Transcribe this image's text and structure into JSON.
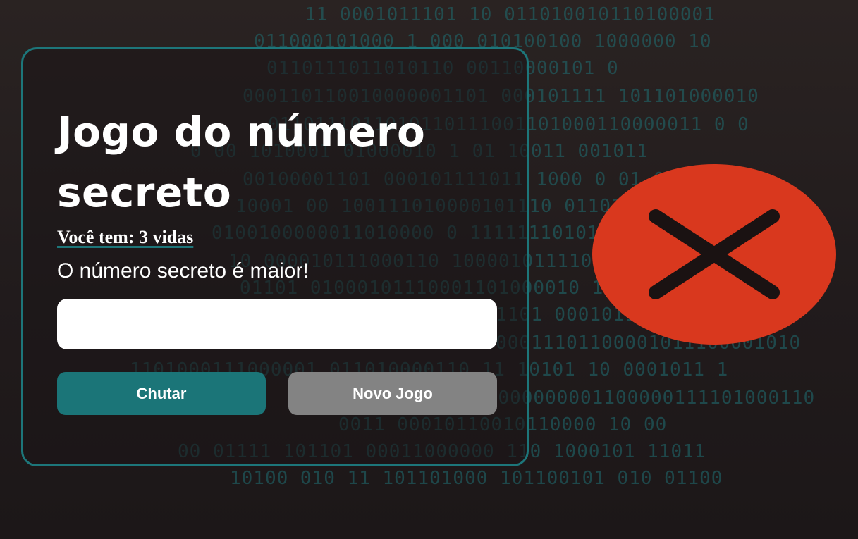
{
  "game": {
    "title": "Jogo do número secreto",
    "lives_text": "Você tem: 3 vidas",
    "message": "O número secreto é maior!",
    "input": {
      "value": "",
      "placeholder": ""
    },
    "buttons": {
      "guess_label": "Chutar",
      "new_game_label": "Novo Jogo"
    }
  },
  "icons": {
    "status": "wrong-answer-x-icon"
  },
  "colors": {
    "accent": "#1d767a",
    "primary_button": "#1b7578",
    "secondary_button": "#838383",
    "error_circle": "#d9381e",
    "background": "#231d1e"
  },
  "background_binary": [
    "11 0001011101 10 011010010110100001",
    "011000101000 1  000 010100100 1000000 10",
    "0110111011010110   00110000101 0",
    "000110110010000001101  000101111  101101000010",
    "0110111011010110111001101000110000011 0 0",
    "0 00 1010001 01000010  1 01 10011   001011",
    "00100001101 000101111011 1000 0 01 0",
    "10001 00 100111010000101110 0110100101",
    "0100100000011010000  0  11111110101 0100011",
    "10 000010111000110 100001011110111  0",
    "01101 01000101110001101000010 111111 01000",
    "0011 0 00000101101 000101100001101000110",
    "0011011100000011101100001011100001010",
    "1101000111000001 011010000110 11 10101 10 0001011 1",
    "0 01 01110100011000000001100000111101000110",
    "0011 00010110010110000 10 00",
    "00 01111  101101 00011000000 110 1000101 11011",
    "10100 010 11 101101000 101100101 010 01100"
  ]
}
